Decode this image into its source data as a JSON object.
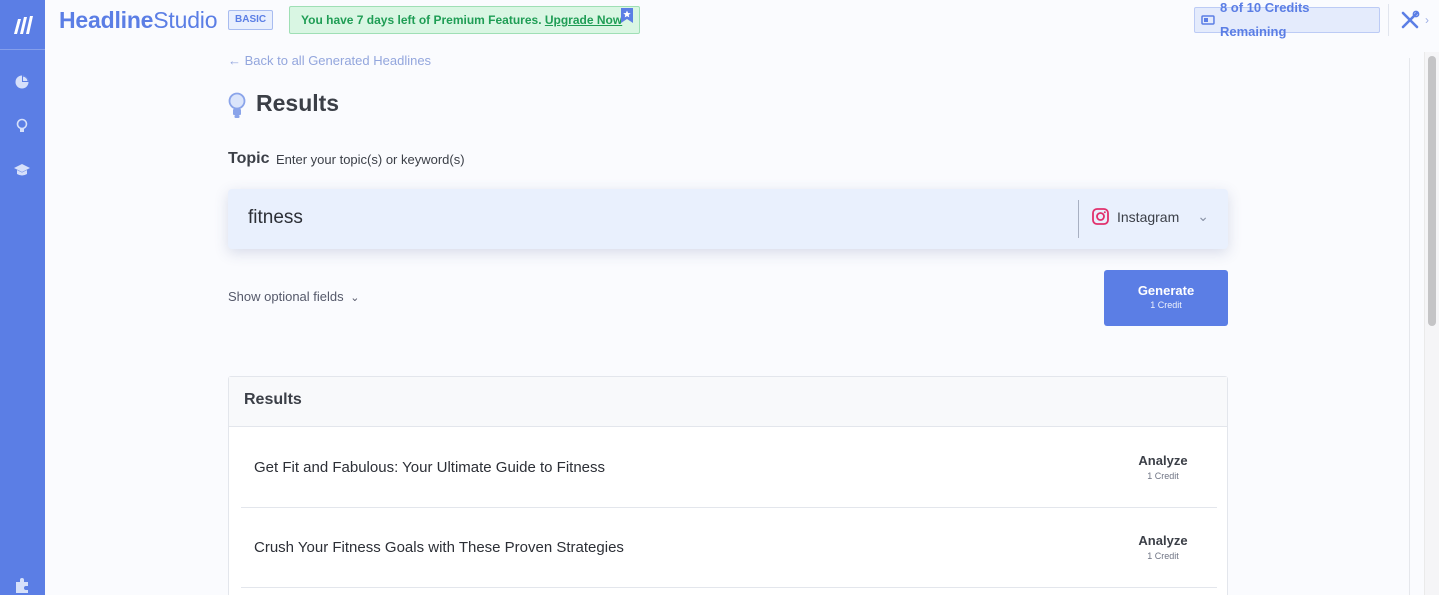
{
  "app": {
    "brand_bold": "Headline",
    "brand_light": "Studio",
    "plan": "BASIC",
    "promo_text": "You have 7 days left of Premium Features. ",
    "promo_link": "Upgrade Now",
    "credits": "8 of 10 Credits Remaining"
  },
  "sidebar": {
    "items": [
      "logo-icon",
      "chart-icon",
      "lightbulb-icon",
      "graduation-cap-icon",
      "puzzle-icon"
    ]
  },
  "main": {
    "back_link": "← Back to all Generated Headlines",
    "title": "Results",
    "topic_label": "Topic",
    "topic_hint": "Enter your topic(s) or keyword(s)",
    "topic_value": "fitness",
    "platform": "Instagram",
    "optional_fields": "Show optional fields",
    "generate_label": "Generate",
    "generate_cost": "1 Credit"
  },
  "results": {
    "heading": "Results",
    "rows": [
      {
        "headline": "Get Fit and Fabulous: Your Ultimate Guide to Fitness",
        "action": "Analyze",
        "cost": "1 Credit"
      },
      {
        "headline": "Crush Your Fitness Goals with These Proven Strategies",
        "action": "Analyze",
        "cost": "1 Credit"
      }
    ]
  },
  "colors": {
    "accent": "#5b7ee5",
    "promo_bg": "#d9f6e3",
    "promo_text": "#1f9d55",
    "instagram": "#e1306c"
  }
}
